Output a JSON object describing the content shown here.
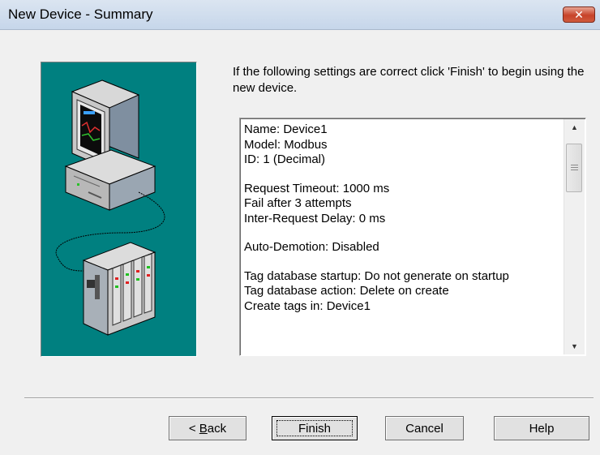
{
  "window": {
    "title": "New Device - Summary",
    "close_glyph": "✕"
  },
  "instruction": "If the following settings are correct click 'Finish' to begin using the new device.",
  "summary": {
    "lines": [
      "Name: Device1",
      "Model: Modbus",
      "ID: 1 (Decimal)",
      "",
      "Request Timeout: 1000 ms",
      "Fail after 3 attempts",
      "Inter-Request Delay: 0 ms",
      "",
      "Auto-Demotion: Disabled",
      "",
      "Tag database startup: Do not generate on startup",
      "Tag database action: Delete on create",
      "Create tags in: Device1"
    ]
  },
  "buttons": {
    "back_prefix": "< ",
    "back_mnemonic": "B",
    "back_rest": "ack",
    "finish": "Finish",
    "cancel": "Cancel",
    "help": "Help"
  },
  "colors": {
    "illustration_bg": "#008080",
    "window_bg": "#f0f0f0",
    "close_button": "#c7432a"
  },
  "icons": {
    "close": "close-icon",
    "computer": "computer-illustration",
    "device": "device-rack-illustration",
    "scroll_up": "scroll-up-arrow-icon",
    "scroll_down": "scroll-down-arrow-icon"
  }
}
